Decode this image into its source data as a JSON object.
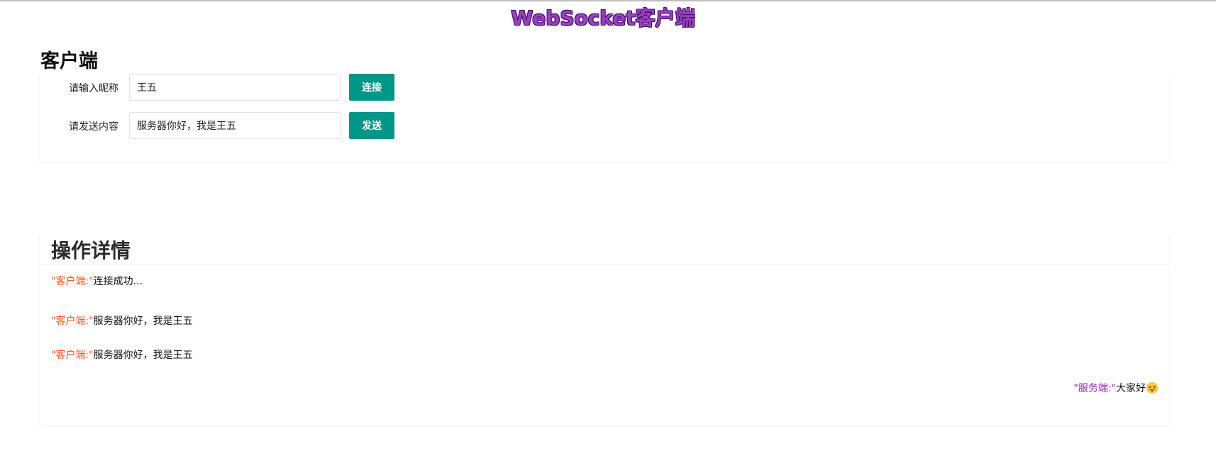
{
  "page": {
    "title": "WebSocket客户端"
  },
  "client": {
    "heading": "客户端",
    "nickname_label": "请输入昵称",
    "nickname_value": "王五",
    "connect_label": "连接",
    "content_label": "请发送内容",
    "content_value": "服务器你好，我是王五",
    "send_label": "发送"
  },
  "log": {
    "heading": "操作详情",
    "messages": [
      {
        "tag": "\"客户端:\"",
        "text": "连接成功...",
        "side": "left"
      },
      {
        "tag": "\"客户端:\"",
        "text": "服务器你好，我是王五",
        "side": "left"
      },
      {
        "tag": "\"客户端:\"",
        "text": "服务器你好，我是王五",
        "side": "left"
      },
      {
        "tag": "\"服务端:\"",
        "text": "大家好",
        "side": "right",
        "icon": "tongue-out-emoji-icon"
      }
    ]
  },
  "colors": {
    "title": "#9b3fc2",
    "accent_button": "#009688",
    "client_tag": "#ff5722",
    "server_tag": "#9c27b0"
  }
}
